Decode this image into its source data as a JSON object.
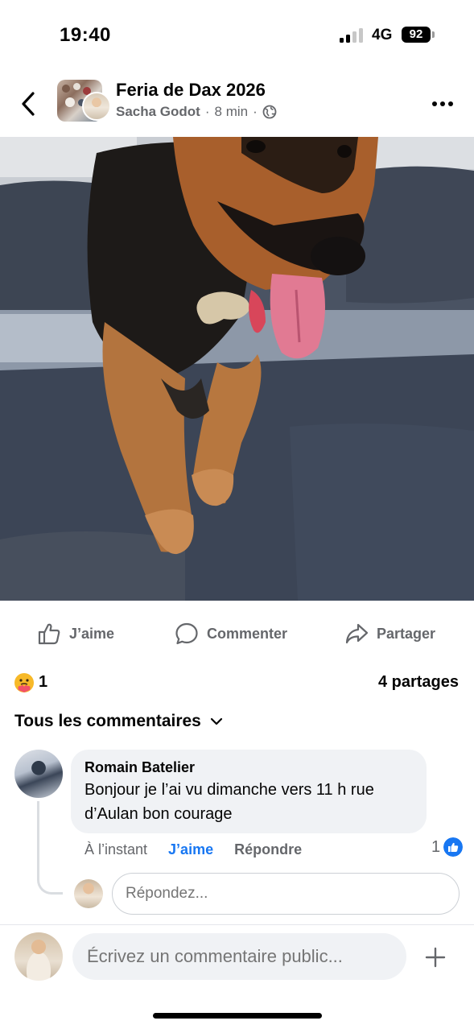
{
  "status_bar": {
    "time": "19:40",
    "network": "4G",
    "battery": "92"
  },
  "header": {
    "group_name": "Feria de Dax 2026",
    "author": "Sacha Godot",
    "separator": "·",
    "time_ago": "8 min",
    "privacy_icon": "globe-icon"
  },
  "post": {
    "image_subject": "photo"
  },
  "actions": {
    "like_label": "J’aime",
    "comment_label": "Commenter",
    "share_label": "Partager"
  },
  "stats": {
    "reaction_icon": "care-emoji",
    "reaction_count": "1",
    "shares": "4 partages"
  },
  "comments": {
    "filter_label": "Tous les commentaires",
    "items": [
      {
        "author": "Romain Batelier",
        "text": "Bonjour je l’ai vu dimanche vers 11 h rue d’Aulan bon courage",
        "time": "À l’instant",
        "like_label": "J’aime",
        "reply_label": "Répondre",
        "like_count": "1"
      }
    ],
    "reply_placeholder": "Répondez..."
  },
  "composer": {
    "placeholder": "Écrivez un commentaire public..."
  },
  "colors": {
    "accent": "#1877f2",
    "secondary_text": "#65676b",
    "bubble": "#f0f2f5"
  }
}
